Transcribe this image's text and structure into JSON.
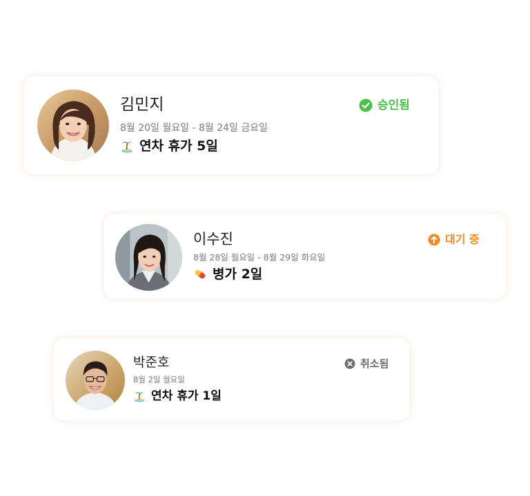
{
  "requests": [
    {
      "name": "김민지",
      "dates": "8월 20일 월요일 - 8월 24일 금요일",
      "leave_type": "연차 휴가 5일",
      "leave_icon": "palm-tree-island-icon",
      "status": "승인됨",
      "status_icon": "check-circle-icon",
      "status_color": "#4cbf4c"
    },
    {
      "name": "이수진",
      "dates": "8월 28일 월요일 - 8월 29일 화요일",
      "leave_type": "병가 2일",
      "leave_icon": "pill-icon",
      "status": "대기 중",
      "status_icon": "arrow-up-circle-icon",
      "status_color": "#f08a24"
    },
    {
      "name": "박준호",
      "dates": "8월 2일 월요일",
      "leave_type": "연차 휴가 1일",
      "leave_icon": "palm-tree-island-icon",
      "status": "취소됨",
      "status_icon": "x-circle-icon",
      "status_color": "#6b6b6b"
    }
  ]
}
